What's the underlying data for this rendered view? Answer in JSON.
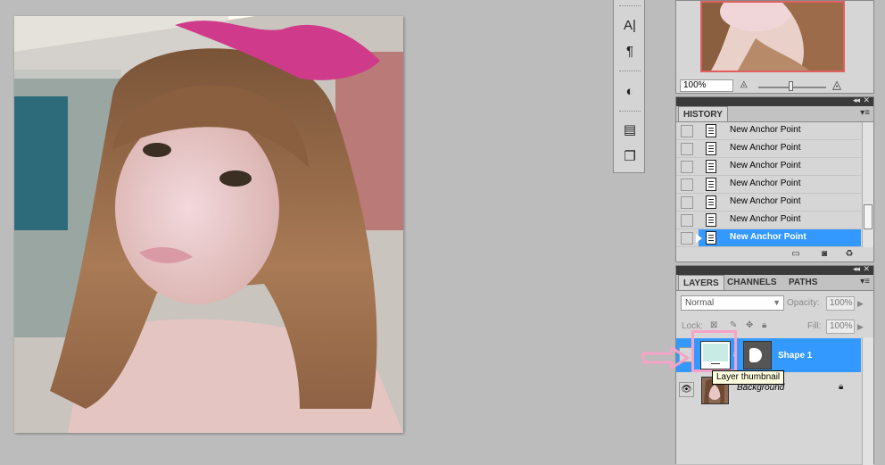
{
  "tools": {
    "items": [
      {
        "name": "character-icon",
        "glyph": "A|"
      },
      {
        "name": "paragraph-icon",
        "glyph": "¶"
      },
      {
        "name": "adjustments-icon",
        "glyph": "◐"
      },
      {
        "name": "notes-icon",
        "glyph": "▤"
      },
      {
        "name": "clone-source-icon",
        "glyph": "❐"
      }
    ]
  },
  "navigator": {
    "zoom": "100%"
  },
  "history": {
    "tab": "HISTORY",
    "items": [
      {
        "label": "New Anchor Point",
        "selected": false
      },
      {
        "label": "New Anchor Point",
        "selected": false
      },
      {
        "label": "New Anchor Point",
        "selected": false
      },
      {
        "label": "New Anchor Point",
        "selected": false
      },
      {
        "label": "New Anchor Point",
        "selected": false
      },
      {
        "label": "New Anchor Point",
        "selected": false
      },
      {
        "label": "New Anchor Point",
        "selected": true
      }
    ]
  },
  "layers": {
    "tabs": [
      "LAYERS",
      "CHANNELS",
      "PATHS"
    ],
    "active_tab": "LAYERS",
    "blend_mode": "Normal",
    "opacity_label": "Opacity:",
    "opacity": "100%",
    "lock_label": "Lock:",
    "fill_label": "Fill:",
    "fill": "100%",
    "items": [
      {
        "name": "Shape 1",
        "selected": true
      },
      {
        "name": "Background",
        "selected": false
      }
    ]
  },
  "tooltip": {
    "text": "Layer thumbnail"
  },
  "colors": {
    "selection": "#3399ff",
    "highlight": "#f5a3c8",
    "panel_bg": "#d6d6d6",
    "workspace_bg": "#bcbcbc"
  }
}
